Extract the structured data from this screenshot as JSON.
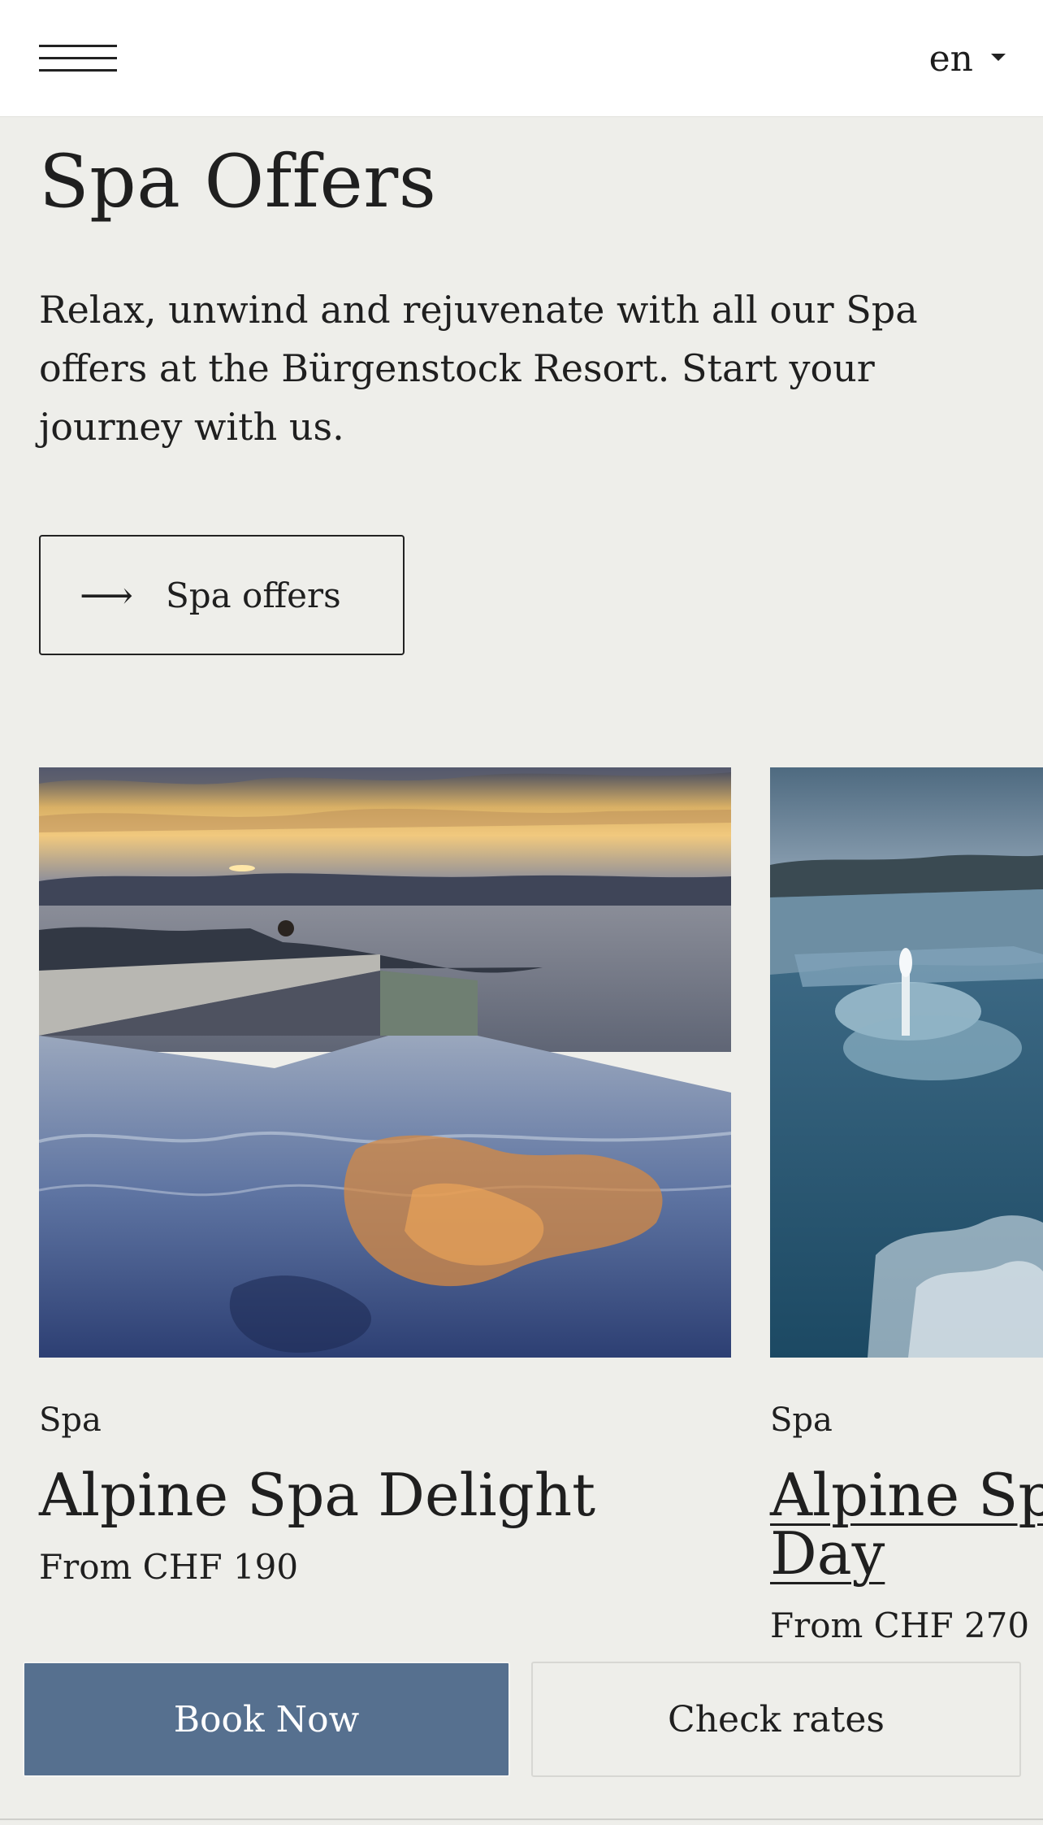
{
  "header": {
    "menu_icon": "hamburger-menu-icon",
    "language": "en",
    "language_icon": "caret-down-icon"
  },
  "hero": {
    "title": "Spa Offers",
    "intro": "Relax, unwind and rejuvenate with all our Spa offers at the Bürgenstock Resort. Start your journey with us.",
    "cta_label": "Spa offers",
    "cta_icon": "arrow-right-icon"
  },
  "offers": [
    {
      "category": "Spa",
      "title": "Alpine Spa Delight",
      "price": "From CHF 190"
    },
    {
      "category": "Spa",
      "title_line1": "Alpine Spa",
      "title_line2": "Day",
      "price": "From CHF 270"
    }
  ],
  "footer_actions": {
    "book_label": "Book Now",
    "rates_label": "Check rates"
  },
  "colors": {
    "page_background": "#eeeeea",
    "header_background": "#ffffff",
    "book_button": "#56708f",
    "text": "#1f1f1f"
  }
}
